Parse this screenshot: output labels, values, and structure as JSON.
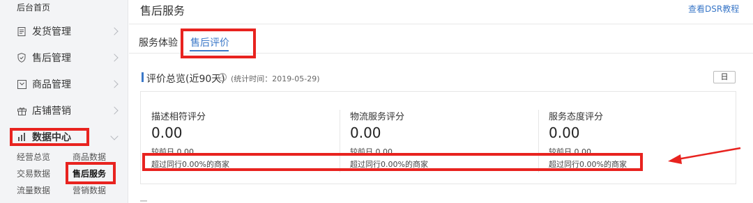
{
  "sidebar": {
    "home": "后台首页",
    "items": [
      {
        "label": "发货管理",
        "icon": "document-icon"
      },
      {
        "label": "售后管理",
        "icon": "shield-icon"
      },
      {
        "label": "商品管理",
        "icon": "product-icon"
      },
      {
        "label": "店铺营销",
        "icon": "gift-icon"
      },
      {
        "label": "数据中心",
        "icon": "bar-chart-icon"
      }
    ],
    "submenu": [
      "经营总览",
      "商品数据",
      "交易数据",
      "售后服务",
      "流量数据",
      "营销数据"
    ]
  },
  "header": {
    "title": "售后服务",
    "dsr_link": "查看DSR教程"
  },
  "tabs": [
    {
      "label": "服务体验",
      "active": false
    },
    {
      "label": "售后评价",
      "active": true
    }
  ],
  "overview": {
    "title": "评价总览(近90天)",
    "help": "?",
    "stat_time": "(统计时间：2019-05-29)",
    "period_button": "日"
  },
  "metrics": [
    {
      "name": "描述相符评分",
      "value": "0.00",
      "compare": "较前日 0.00",
      "exceed": "超过同行0.00%的商家"
    },
    {
      "name": "物流服务评分",
      "value": "0.00",
      "compare": "较前日 0.00",
      "exceed": "超过同行0.00%的商家"
    },
    {
      "name": "服务态度评分",
      "value": "0.00",
      "compare": "较前日 0.00",
      "exceed": "超过同行0.00%的商家"
    }
  ],
  "colors": {
    "accent": "#3b78c8",
    "annotation_red": "#e8231f"
  }
}
